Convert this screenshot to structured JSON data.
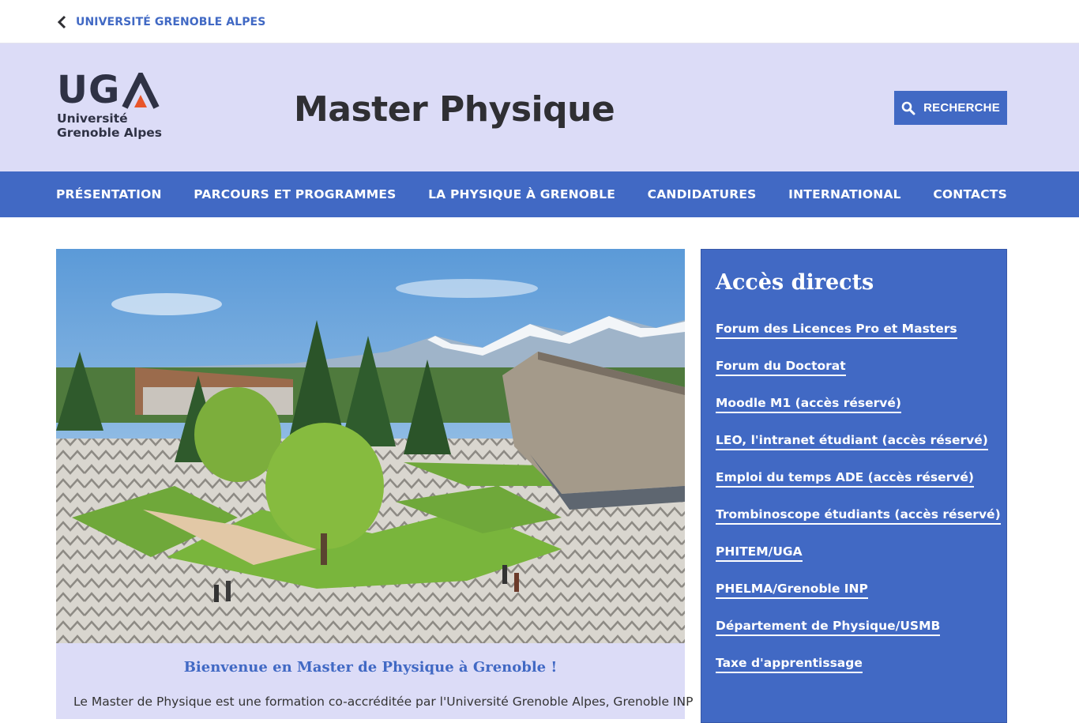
{
  "topbar": {
    "back_label": "UNIVERSITÉ GRENOBLE ALPES"
  },
  "logo": {
    "letters": "UG",
    "line1": "Université",
    "line2": "Grenoble Alpes"
  },
  "header": {
    "title": "Master Physique",
    "search_label": "RECHERCHE"
  },
  "nav": {
    "items": [
      {
        "label": "PRÉSENTATION"
      },
      {
        "label": "PARCOURS ET PROGRAMMES"
      },
      {
        "label": "LA PHYSIQUE À GRENOBLE"
      },
      {
        "label": "CANDIDATURES"
      },
      {
        "label": "INTERNATIONAL"
      },
      {
        "label": "CONTACTS"
      }
    ]
  },
  "welcome": {
    "title": "Bienvenue en Master de Physique à Grenoble !",
    "text": "Le Master de Physique est une formation co-accréditée par l'Université Grenoble Alpes, Grenoble INP"
  },
  "aside": {
    "title": "Accès directs",
    "links": [
      {
        "label": "Forum des Licences Pro et Masters"
      },
      {
        "label": "Forum du Doctorat"
      },
      {
        "label": "Moodle M1 (accès réservé)"
      },
      {
        "label": "LEO, l'intranet étudiant (accès réservé)"
      },
      {
        "label": "Emploi du temps ADE (accès réservé)"
      },
      {
        "label": "Trombinoscope étudiants (accès réservé)"
      },
      {
        "label": "PHITEM/UGA"
      },
      {
        "label": "PHELMA/Grenoble INP"
      },
      {
        "label": "Département de Physique/USMB"
      },
      {
        "label": "Taxe d'apprentissage"
      }
    ]
  },
  "colors": {
    "accent": "#4169c4",
    "header_bg": "#dcdcf7",
    "logo_orange": "#e8552a",
    "logo_dark": "#2f3245"
  },
  "icons": {
    "back": "chevron-left-icon",
    "search": "search-icon"
  }
}
